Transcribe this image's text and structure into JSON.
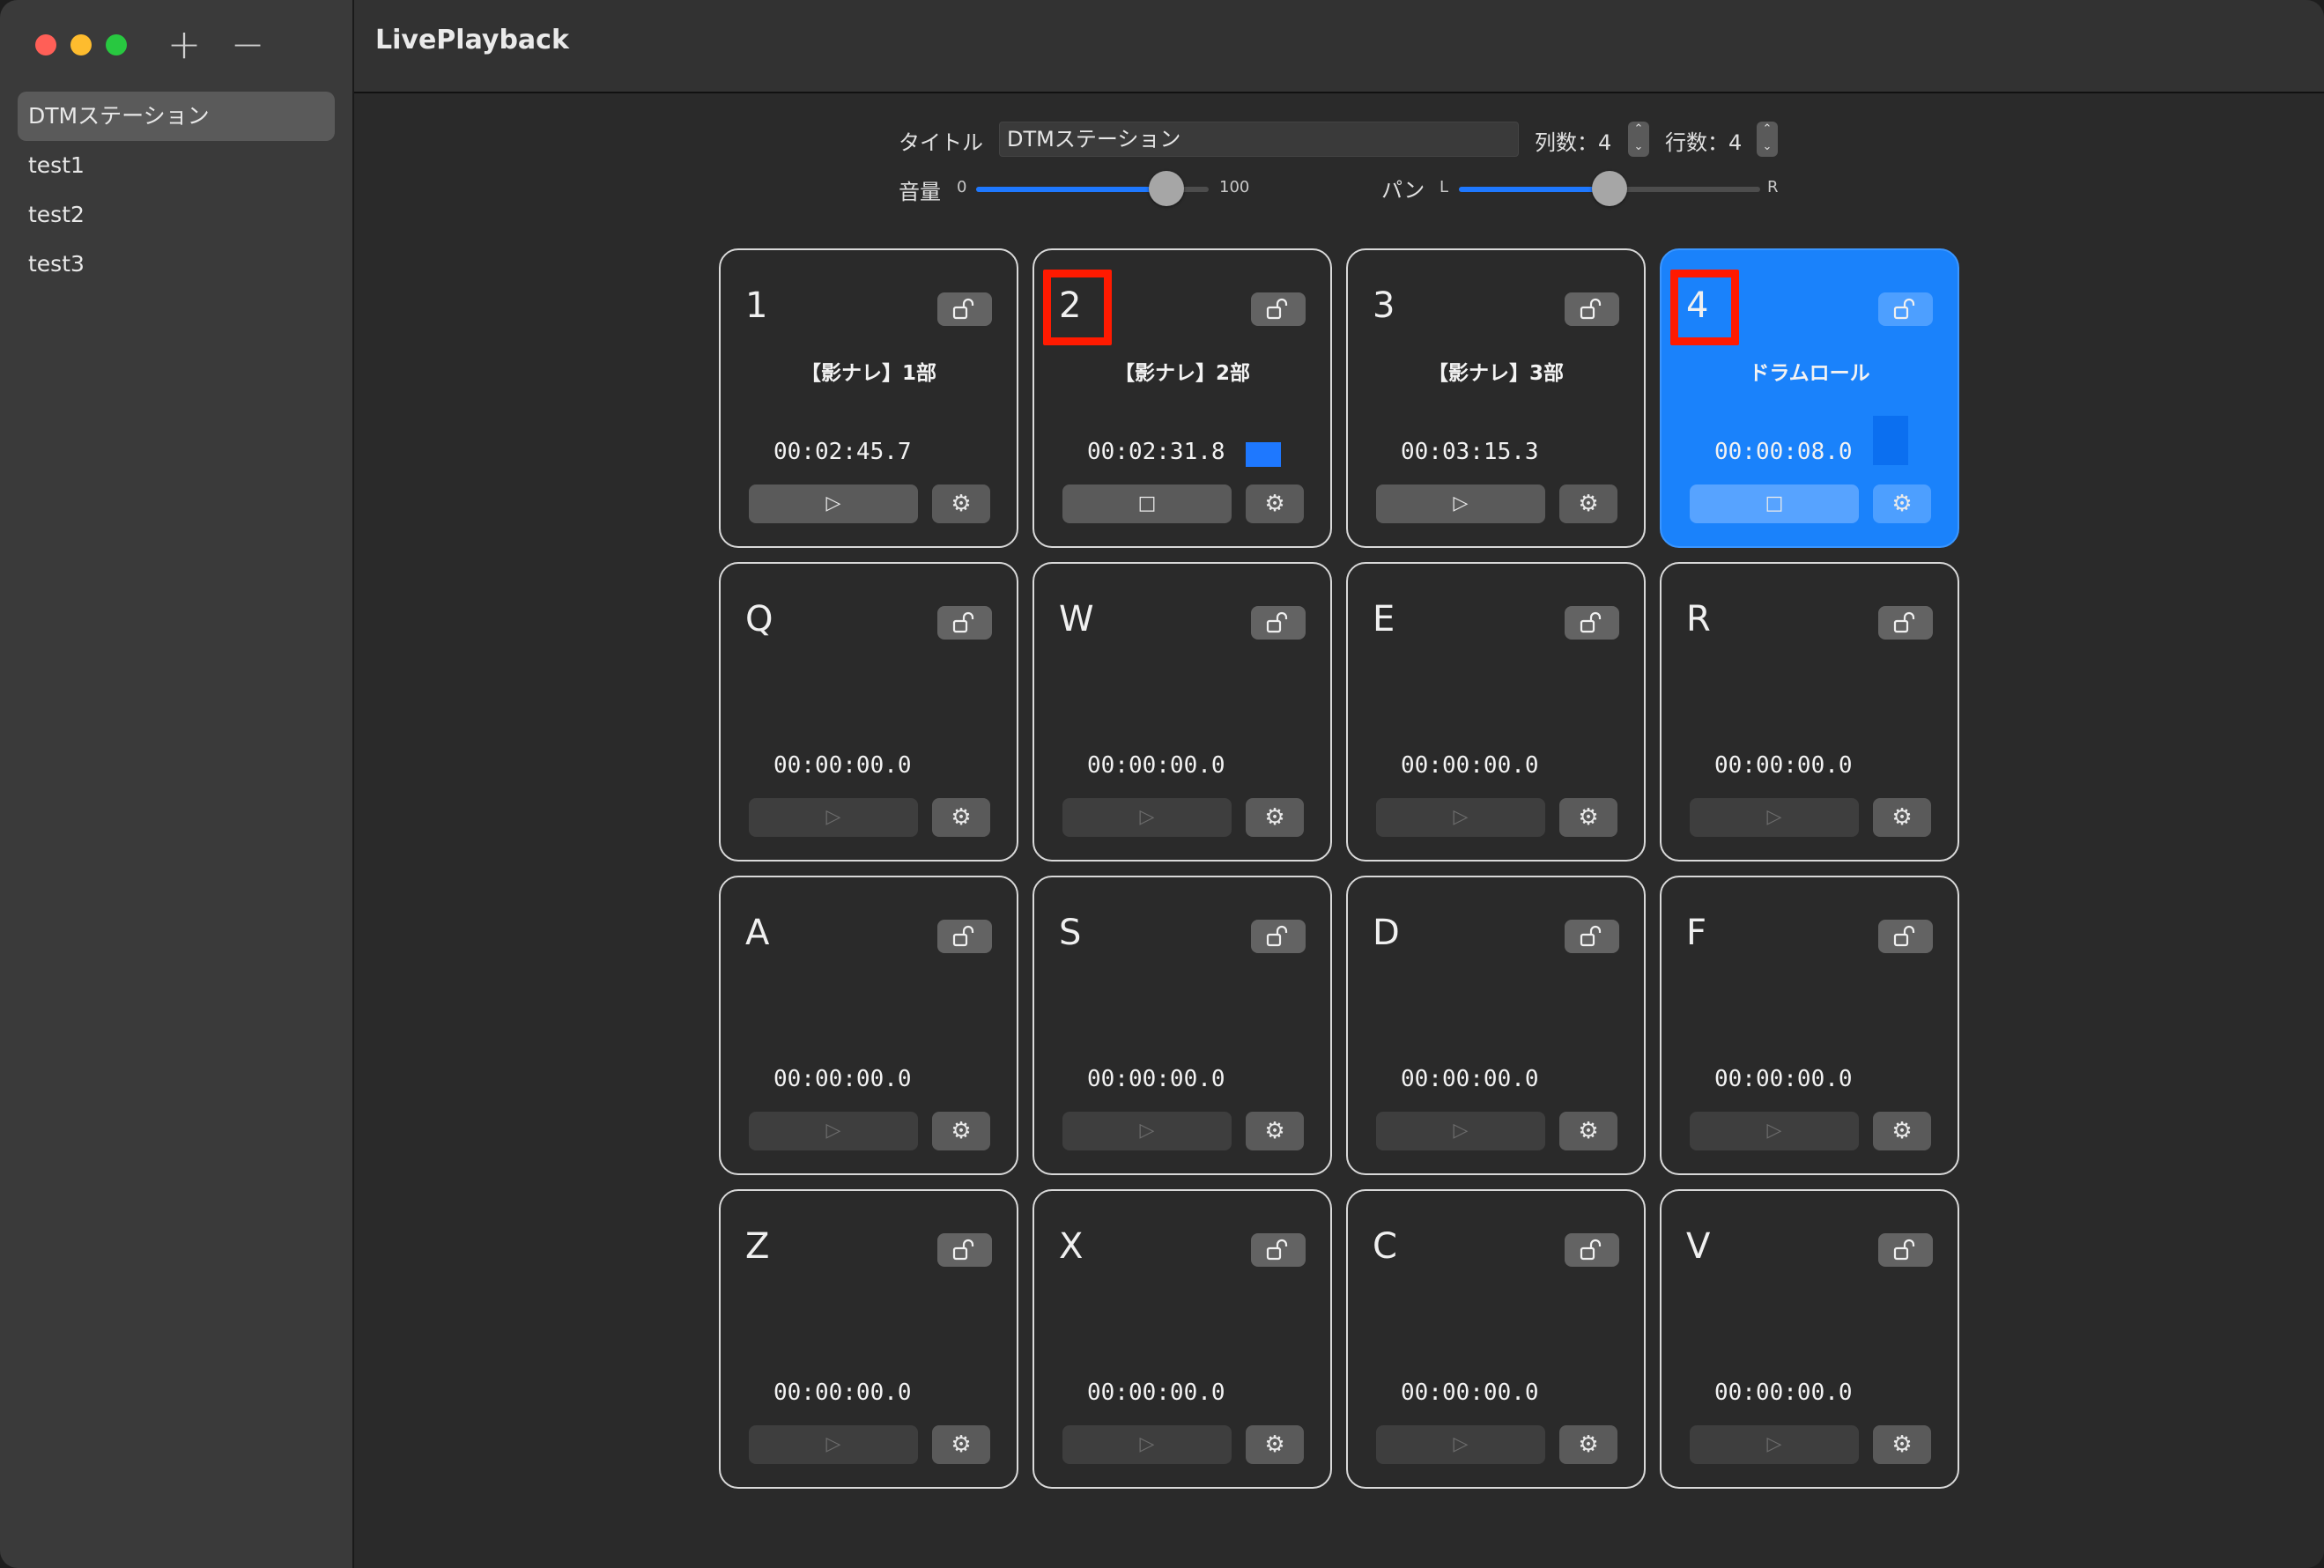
{
  "app": {
    "title": "LivePlayback"
  },
  "sidebar": {
    "add_label": "+",
    "remove_label": "−",
    "items": [
      {
        "label": "DTMステーション",
        "selected": true
      },
      {
        "label": "test1",
        "selected": false
      },
      {
        "label": "test2",
        "selected": false
      },
      {
        "label": "test3",
        "selected": false
      }
    ]
  },
  "controls": {
    "title_label": "タイトル",
    "title_value": "DTMステーション",
    "columns_label": "列数：4",
    "rows_label": "行数：4",
    "volume_label": "音量",
    "volume_min": "0",
    "volume_max": "100",
    "volume_value": 82,
    "pan_label": "パン",
    "pan_left": "L",
    "pan_right": "R",
    "pan_value": 0.5
  },
  "icons": {
    "lock": "lock-open-icon",
    "play": "▷",
    "stop": "□",
    "gear": "⚙"
  },
  "colors": {
    "accent": "#1a82fb",
    "highlight": "#ff1a00"
  },
  "pads": [
    {
      "key": "1",
      "name": "【影ナレ】1部",
      "time": "00:02:45.7",
      "state": "play",
      "loaded": true,
      "active": false,
      "level": false
    },
    {
      "key": "2",
      "name": "【影ナレ】2部",
      "time": "00:02:31.8",
      "state": "stop",
      "loaded": true,
      "active": false,
      "level": true,
      "highlight": true
    },
    {
      "key": "3",
      "name": "【影ナレ】3部",
      "time": "00:03:15.3",
      "state": "play",
      "loaded": true,
      "active": false,
      "level": false
    },
    {
      "key": "4",
      "name": "ドラムロール",
      "time": "00:00:08.0",
      "state": "stop",
      "loaded": true,
      "active": true,
      "level": true,
      "highlight": true
    },
    {
      "key": "Q",
      "name": "",
      "time": "00:00:00.0",
      "state": "play",
      "loaded": false,
      "active": false,
      "level": false
    },
    {
      "key": "W",
      "name": "",
      "time": "00:00:00.0",
      "state": "play",
      "loaded": false,
      "active": false,
      "level": false
    },
    {
      "key": "E",
      "name": "",
      "time": "00:00:00.0",
      "state": "play",
      "loaded": false,
      "active": false,
      "level": false
    },
    {
      "key": "R",
      "name": "",
      "time": "00:00:00.0",
      "state": "play",
      "loaded": false,
      "active": false,
      "level": false
    },
    {
      "key": "A",
      "name": "",
      "time": "00:00:00.0",
      "state": "play",
      "loaded": false,
      "active": false,
      "level": false
    },
    {
      "key": "S",
      "name": "",
      "time": "00:00:00.0",
      "state": "play",
      "loaded": false,
      "active": false,
      "level": false
    },
    {
      "key": "D",
      "name": "",
      "time": "00:00:00.0",
      "state": "play",
      "loaded": false,
      "active": false,
      "level": false
    },
    {
      "key": "F",
      "name": "",
      "time": "00:00:00.0",
      "state": "play",
      "loaded": false,
      "active": false,
      "level": false
    },
    {
      "key": "Z",
      "name": "",
      "time": "00:00:00.0",
      "state": "play",
      "loaded": false,
      "active": false,
      "level": false
    },
    {
      "key": "X",
      "name": "",
      "time": "00:00:00.0",
      "state": "play",
      "loaded": false,
      "active": false,
      "level": false
    },
    {
      "key": "C",
      "name": "",
      "time": "00:00:00.0",
      "state": "play",
      "loaded": false,
      "active": false,
      "level": false
    },
    {
      "key": "V",
      "name": "",
      "time": "00:00:00.0",
      "state": "play",
      "loaded": false,
      "active": false,
      "level": false
    }
  ]
}
